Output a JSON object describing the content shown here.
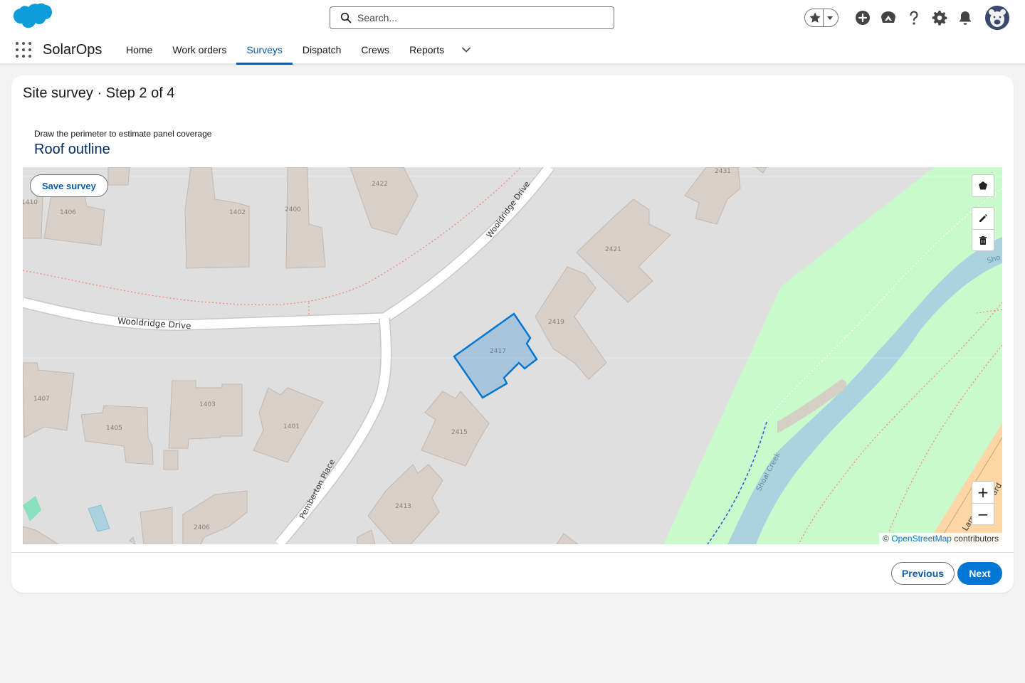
{
  "header": {
    "search_placeholder": "Search...",
    "icons": [
      "favorites-star-icon",
      "favorites-dropdown-icon",
      "global-add-icon",
      "trailhead-icon",
      "help-icon",
      "setup-gear-icon",
      "notifications-bell-icon",
      "user-avatar"
    ]
  },
  "nav": {
    "app_name": "SolarOps",
    "items": [
      "Home",
      "Work orders",
      "Surveys",
      "Dispatch",
      "Crews",
      "Reports"
    ],
    "active": "Surveys"
  },
  "page": {
    "title": "Site survey · Step 2 of 4",
    "field_help": "Draw the perimeter to estimate panel coverage",
    "field_label": "Roof outline"
  },
  "map": {
    "save_label": "Save survey",
    "streets": [
      "Wooldridge Drive",
      "Wooldridge Drive",
      "Pemberton Place",
      "Shoal Creek",
      "Sho",
      "Lama",
      "ard"
    ],
    "buildings": [
      "1410",
      "1406",
      "1402",
      "2400",
      "2422",
      "2431",
      "2421",
      "2419",
      "2417",
      "1407",
      "1405",
      "1403",
      "1401",
      "2415",
      "2413",
      "2406"
    ],
    "selected_building": "2417",
    "draw_tools": [
      "draw-polygon-icon",
      "edit-pencil-icon",
      "delete-trash-icon"
    ],
    "zoom_in": "+",
    "zoom_out": "−",
    "attribution_prefix": "©",
    "attribution_link": "OpenStreetMap",
    "attribution_suffix": "contributors",
    "colors": {
      "land": "#e0dfdf",
      "building": "#d9d0c9",
      "park": "#c8facc",
      "water": "#aad3df",
      "road": "#ffffff",
      "outline": "#0176d3"
    }
  },
  "footer": {
    "previous_label": "Previous",
    "next_label": "Next"
  }
}
